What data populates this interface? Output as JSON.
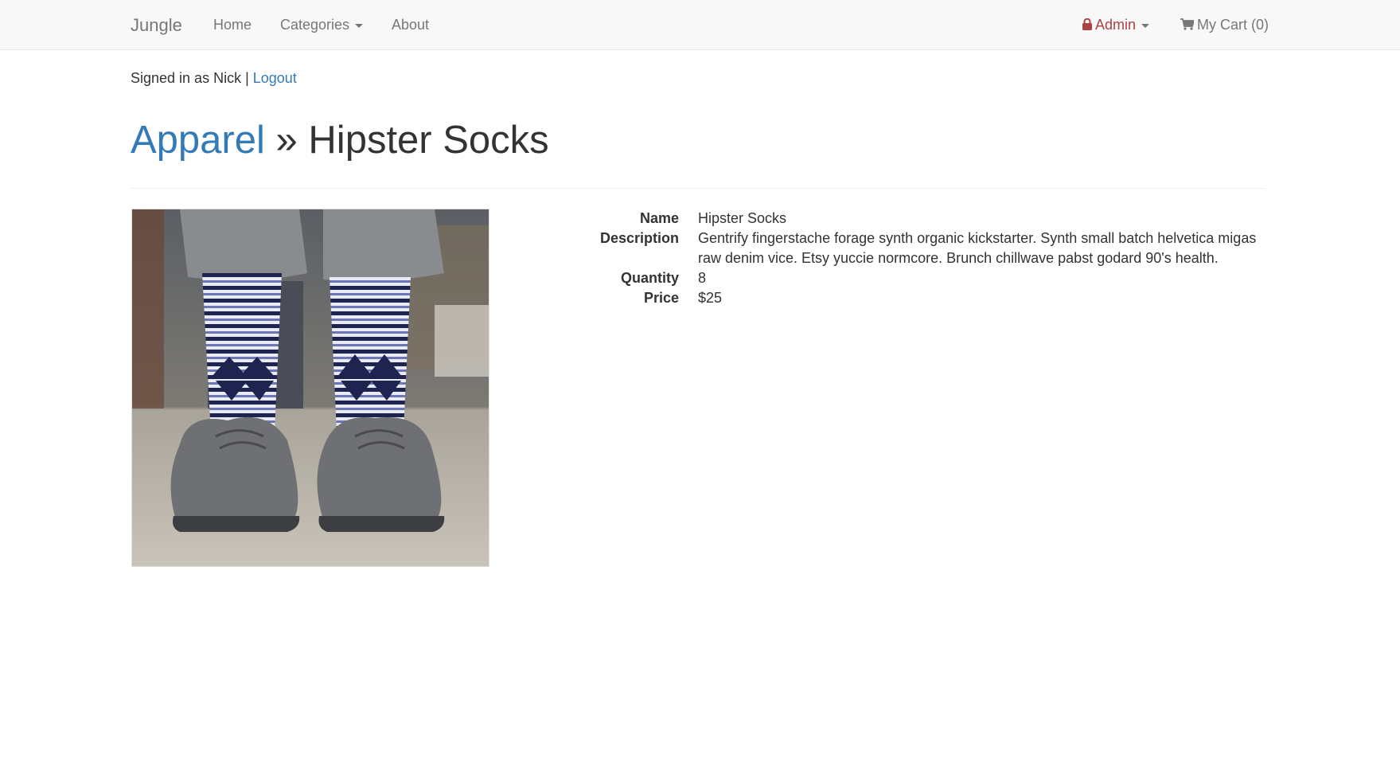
{
  "navbar": {
    "brand": "Jungle",
    "home": "Home",
    "categories": "Categories",
    "about": "About",
    "admin": "Admin",
    "cart": "My Cart (0)"
  },
  "session": {
    "signed_in_text": "Signed in as Nick |",
    "logout": "Logout"
  },
  "header": {
    "category": "Apparel",
    "separator": "»",
    "product": "Hipster Socks"
  },
  "product": {
    "image_icon": "product-photo-socks",
    "fields": [
      {
        "label": "Name",
        "value": "Hipster Socks"
      },
      {
        "label": "Description",
        "value": "Gentrify fingerstache forage synth organic kickstarter. Synth small batch helvetica migas raw denim vice. Etsy yuccie normcore. Brunch chillwave pabst godard 90's health."
      },
      {
        "label": "Quantity",
        "value": "8"
      },
      {
        "label": "Price",
        "value": "$25"
      }
    ]
  },
  "colors": {
    "link": "#337ab7",
    "admin": "#a94442",
    "navbar_bg": "#f8f8f8"
  }
}
